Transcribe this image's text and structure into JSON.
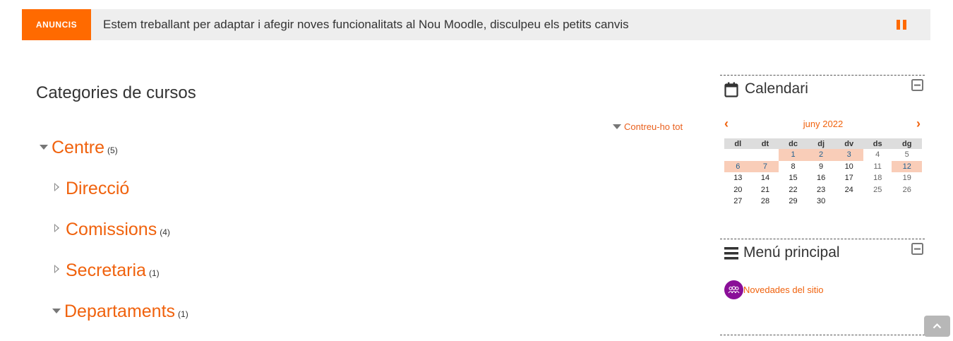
{
  "announcement": {
    "label": "ANUNCIS",
    "text": "Estem treballant per adaptar i afegir noves funcionalitats al Nou Moodle, disculpeu els petits canvis",
    "pause_icon": "pause-icon"
  },
  "main": {
    "title": "Categories de cursos",
    "collapse_all": "Contreu-ho tot",
    "categories": [
      {
        "name": "Centre",
        "count": "(5)",
        "expanded": true
      },
      {
        "name": "Direcció",
        "count": "",
        "expanded": false
      },
      {
        "name": "Comissions",
        "count": "(4)",
        "expanded": false
      },
      {
        "name": "Secretaria",
        "count": "(1)",
        "expanded": false
      },
      {
        "name": "Departaments",
        "count": "(1)",
        "expanded": true
      }
    ]
  },
  "calendar": {
    "title": "Calendari",
    "month": "juny 2022",
    "prev": "‹",
    "next": "›",
    "weekdays": [
      "dl",
      "dt",
      "dc",
      "dj",
      "dv",
      "ds",
      "dg"
    ],
    "weeks": [
      [
        "",
        "",
        "1",
        "2",
        "3",
        "4",
        "5"
      ],
      [
        "6",
        "7",
        "8",
        "9",
        "10",
        "11",
        "12"
      ],
      [
        "13",
        "14",
        "15",
        "16",
        "17",
        "18",
        "19"
      ],
      [
        "20",
        "21",
        "22",
        "23",
        "24",
        "25",
        "26"
      ],
      [
        "27",
        "28",
        "29",
        "30",
        "",
        "",
        ""
      ]
    ],
    "event_days": [
      "1",
      "2",
      "3",
      "6",
      "7",
      "12"
    ]
  },
  "main_menu": {
    "title": "Menú principal",
    "link": "Novedades del sitio"
  },
  "colors": {
    "accent": "#f0620d",
    "banner": "#ff6a00",
    "event_bg": "#f9cdb8",
    "forum_icon": "#8a0f98"
  }
}
